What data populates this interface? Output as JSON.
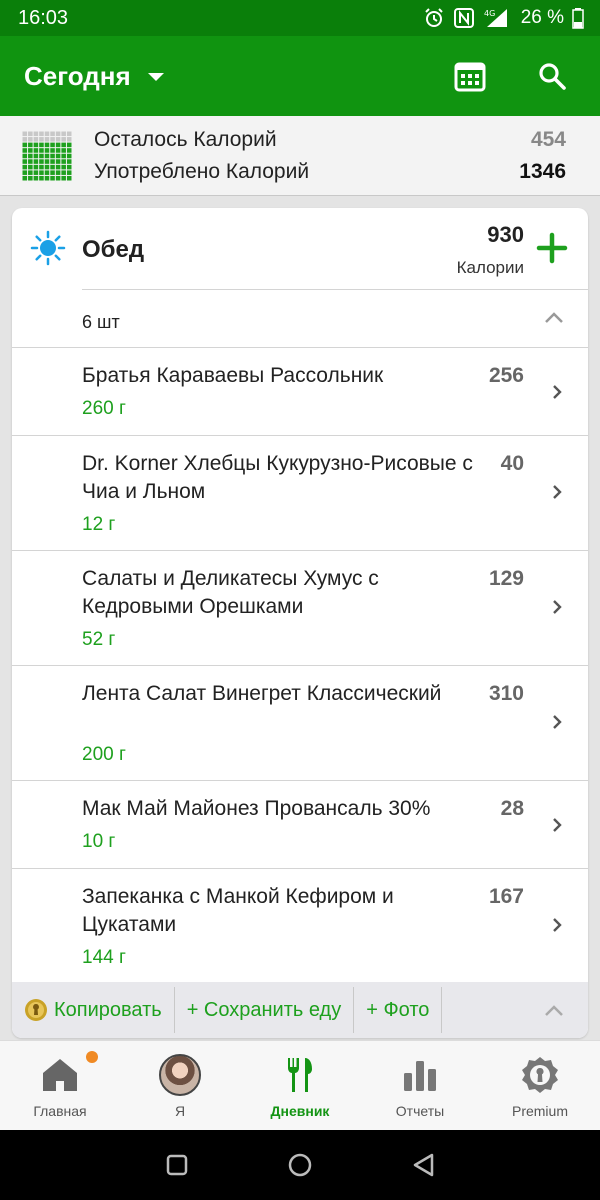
{
  "status_bar": {
    "time": "16:03",
    "battery": "26 %"
  },
  "app_bar": {
    "title": "Сегодня"
  },
  "summary": {
    "remaining_label": "Осталось Калорий",
    "remaining_value": "454",
    "consumed_label": "Употреблено Калорий",
    "consumed_value": "1346"
  },
  "meal": {
    "title": "Обед",
    "calories": "930",
    "calories_label": "Калории",
    "count": "6 шт",
    "items": [
      {
        "name": "Братья Караваевы Рассольник",
        "calories": "256",
        "weight": "260 г"
      },
      {
        "name": "Dr. Korner Хлебцы Кукурузно-Рисовые с Чиа и Льном",
        "calories": "40",
        "weight": "12 г"
      },
      {
        "name": "Салаты и Деликатесы Хумус с Кедровыми Орешками",
        "calories": "129",
        "weight": "52 г"
      },
      {
        "name": "Лента Салат Винегрет Классический",
        "calories": "310",
        "weight": "200 г"
      },
      {
        "name": "Мак Май Майонез Провансаль 30%",
        "calories": "28",
        "weight": "10 г"
      },
      {
        "name": "Запеканка с Манкой Кефиром и Цукатами",
        "calories": "167",
        "weight": "144 г"
      }
    ],
    "actions": {
      "copy": "Копировать",
      "save_food": "+ Сохранить еду",
      "photo": "+ Фото"
    }
  },
  "bottom_nav": {
    "home": "Главная",
    "me": "Я",
    "diary": "Дневник",
    "reports": "Отчеты",
    "premium": "Premium"
  },
  "colors": {
    "primary": "#109410",
    "status_bar": "#0a7f0a",
    "accent_green": "#1ea01e",
    "notification_dot": "#f08a24"
  },
  "icons": [
    "alarm-icon",
    "nfc-icon",
    "signal-4g-icon",
    "battery-icon",
    "calendar-icon",
    "search-icon",
    "sun-icon",
    "plus-icon",
    "chevron-up-icon",
    "chevron-right-icon",
    "coin-icon",
    "home-icon",
    "fork-knife-icon",
    "bar-chart-icon",
    "premium-badge-icon"
  ]
}
